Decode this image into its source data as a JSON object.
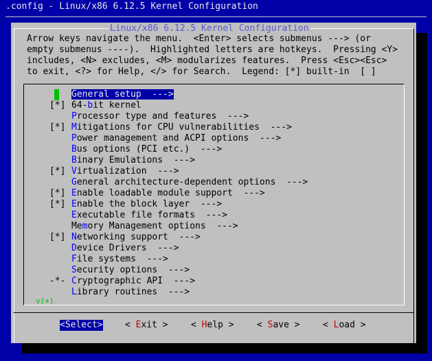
{
  "window_title": ".config - Linux/x86 6.12.5 Kernel Configuration",
  "dialog": {
    "title": "Linux/x86 6.12.5 Kernel Configuration",
    "help_lines": [
      "Arrow keys navigate the menu.  <Enter> selects submenus ---> (or",
      "empty submenus ----).  Highlighted letters are hotkeys.  Pressing <Y>",
      "includes, <N> excludes, <M> modularizes features.  Press <Esc><Esc>",
      "to exit, <?> for Help, </> for Search.  Legend: [*] built-in  [ ]"
    ]
  },
  "menu": {
    "selected_index": 0,
    "more_indicator": "v(+)",
    "items": [
      {
        "marker": "",
        "pre": "",
        "hot": "G",
        "post": "eneral setup  --->"
      },
      {
        "marker": "[*]",
        "pre": "64-",
        "hot": "b",
        "post": "it kernel"
      },
      {
        "marker": "",
        "pre": "",
        "hot": "P",
        "post": "rocessor type and features  --->"
      },
      {
        "marker": "[*]",
        "pre": "",
        "hot": "M",
        "post": "itigations for CPU vulnerabilities  --->"
      },
      {
        "marker": "",
        "pre": "",
        "hot": "P",
        "post": "ower management and ACPI options  --->"
      },
      {
        "marker": "",
        "pre": "",
        "hot": "B",
        "post": "us options (PCI etc.)  --->"
      },
      {
        "marker": "",
        "pre": "",
        "hot": "B",
        "post": "inary Emulations  --->"
      },
      {
        "marker": "[*]",
        "pre": "",
        "hot": "V",
        "post": "irtualization  --->"
      },
      {
        "marker": "",
        "pre": "",
        "hot": "G",
        "post": "eneral architecture-dependent options  --->"
      },
      {
        "marker": "[*]",
        "pre": "",
        "hot": "E",
        "post": "nable loadable module support  --->"
      },
      {
        "marker": "[*]",
        "pre": "",
        "hot": "E",
        "post": "nable the block layer  --->"
      },
      {
        "marker": "",
        "pre": "",
        "hot": "E",
        "post": "xecutable file formats  --->"
      },
      {
        "marker": "",
        "pre": "Me",
        "hot": "m",
        "post": "ory Management options  --->"
      },
      {
        "marker": "[*]",
        "pre": "",
        "hot": "N",
        "post": "etworking support  --->"
      },
      {
        "marker": "",
        "pre": "",
        "hot": "D",
        "post": "evice Drivers  --->"
      },
      {
        "marker": "",
        "pre": "",
        "hot": "F",
        "post": "ile systems  --->"
      },
      {
        "marker": "",
        "pre": "",
        "hot": "S",
        "post": "ecurity options  --->"
      },
      {
        "marker": "-*-",
        "pre": "",
        "hot": "C",
        "post": "ryptographic API  --->"
      },
      {
        "marker": "",
        "pre": "",
        "hot": "L",
        "post": "ibrary routines  --->"
      }
    ]
  },
  "buttons": [
    {
      "lt": "<",
      "hot": "S",
      "rest": "elect",
      "gt": ">",
      "selected": true
    },
    {
      "lt": "< ",
      "hot": "E",
      "rest": "xit",
      "gt": " >",
      "selected": false
    },
    {
      "lt": "< ",
      "hot": "H",
      "rest": "elp",
      "gt": " >",
      "selected": false
    },
    {
      "lt": "< ",
      "hot": "S",
      "rest": "ave",
      "gt": " >",
      "selected": false
    },
    {
      "lt": "< ",
      "hot": "L",
      "rest": "oad",
      "gt": " >",
      "selected": false
    }
  ],
  "colors": {
    "screen_bg": "#0000a8",
    "dialog_bg": "#c0c0c0",
    "hotkey": "#0000ff",
    "button_hotkey": "#c00000",
    "cursor": "#00c000"
  }
}
